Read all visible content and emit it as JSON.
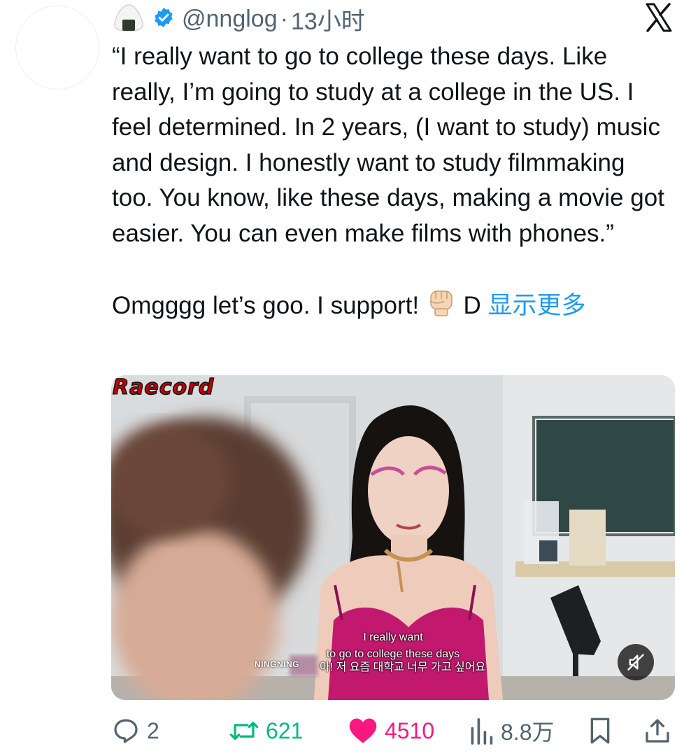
{
  "header": {
    "handle": "@nnglog",
    "separator": "·",
    "time": "13小时",
    "verified": true,
    "avatar_icon": "onigiri-icon",
    "app_icon": "x-logo-icon"
  },
  "tweet": {
    "text": "“I really want to go to college these days. Like really, I’m going to study at a college in the US. I feel determined. In 2 years, (I want to study) music and design. I honestly want to study filmmaking too. You know, like these days, making a movie got easier. You can even make films with phones.”\n\nOmgggg let’s goo. I support! ",
    "emoji": "raised-fist-icon",
    "trailing": " D ",
    "show_more": "显示更多"
  },
  "media": {
    "watermark": "Raecord",
    "subtitle_line1": "I really want",
    "subtitle_line2": "to go to college these days",
    "speaker": "NINGNING",
    "subtitle_kr": "아! 저 요즘 대학교 너무 가고 싶어요",
    "mute_icon": "muted-speaker-icon"
  },
  "actions": {
    "replies": "2",
    "retweets": "621",
    "likes": "4510",
    "views": "8.8万"
  },
  "colors": {
    "link": "#1d9bf0",
    "retweet": "#00ba7c",
    "like": "#f91880",
    "muted": "#536471"
  }
}
